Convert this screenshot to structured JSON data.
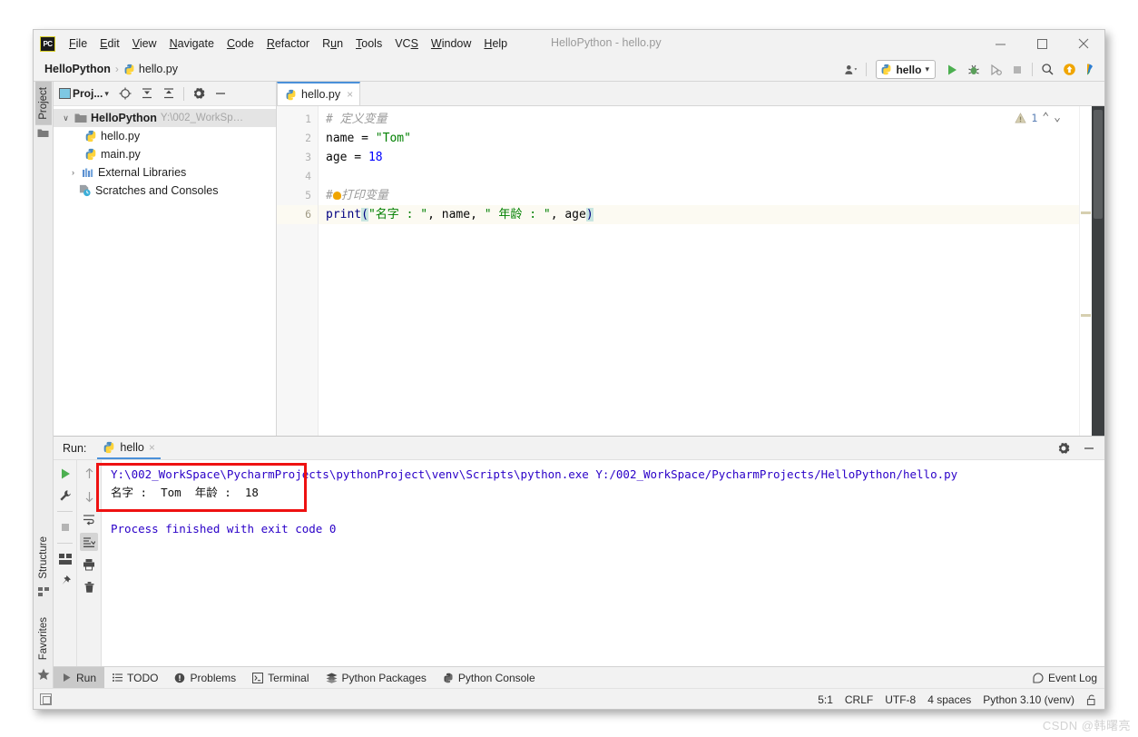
{
  "window": {
    "title": "HelloPython - hello.py",
    "logo_text": "PC",
    "minimize": "—",
    "maximize": "□",
    "close": "×"
  },
  "menu": [
    {
      "label": "File",
      "mnemonic": "F"
    },
    {
      "label": "Edit",
      "mnemonic": "E"
    },
    {
      "label": "View",
      "mnemonic": "V"
    },
    {
      "label": "Navigate",
      "mnemonic": "N"
    },
    {
      "label": "Code",
      "mnemonic": "C"
    },
    {
      "label": "Refactor",
      "mnemonic": "R"
    },
    {
      "label": "Run",
      "mnemonic": "u"
    },
    {
      "label": "Tools",
      "mnemonic": "T"
    },
    {
      "label": "VCS",
      "mnemonic": "S"
    },
    {
      "label": "Window",
      "mnemonic": "W"
    },
    {
      "label": "Help",
      "mnemonic": "H"
    }
  ],
  "navbar": {
    "crumb_project": "HelloPython",
    "crumb_sep": "›",
    "crumb_file": "hello.py",
    "run_config": "hello",
    "run_config_caret": "▾",
    "profile_caret": "▾"
  },
  "left_rail": {
    "project_tab": "Project",
    "structure_tab": "Structure",
    "favorites_tab": "Favorites"
  },
  "project_panel": {
    "title": "Proj...",
    "title_caret": "▾",
    "tree": [
      {
        "label": "HelloPython",
        "path": "Y:\\002_WorkSp…",
        "arrow": "∨",
        "bold": true,
        "selected": true,
        "indent": 0,
        "icon": "folder-icon"
      },
      {
        "label": "hello.py",
        "path": "",
        "arrow": "",
        "bold": false,
        "selected": false,
        "indent": 1,
        "icon": "python-file-icon"
      },
      {
        "label": "main.py",
        "path": "",
        "arrow": "",
        "bold": false,
        "selected": false,
        "indent": 1,
        "icon": "python-file-icon"
      },
      {
        "label": "External Libraries",
        "path": "",
        "arrow": "›",
        "bold": false,
        "selected": false,
        "indent": 0,
        "icon": "library-icon"
      },
      {
        "label": "Scratches and Consoles",
        "path": "",
        "arrow": "",
        "bold": false,
        "selected": false,
        "indent": 0,
        "icon": "scratches-icon"
      }
    ]
  },
  "editor": {
    "tab_name": "hello.py",
    "tab_close": "×",
    "inspection_count": "1",
    "inspection_up": "⌃",
    "inspection_down": "⌄",
    "line_numbers": [
      "1",
      "2",
      "3",
      "4",
      "5",
      "6"
    ],
    "current_line": 6,
    "code": {
      "l1_comment": "# 定义变量",
      "l2_var": "name",
      "l2_eq": " = ",
      "l2_str": "\"Tom\"",
      "l3_var": "age",
      "l3_eq": " = ",
      "l3_num": "18",
      "l4_blank": "",
      "l5_hash": "#",
      "l5_comment": "打印变量",
      "l6_fn": "print",
      "l6_open": "(",
      "l6_str1": "\"名字 : \"",
      "l6_c1": ", ",
      "l6_v1": "name",
      "l6_c2": ", ",
      "l6_str2": "\" 年龄 : \"",
      "l6_c3": ", ",
      "l6_v2": "age",
      "l6_close": ")"
    }
  },
  "run_panel": {
    "label": "Run:",
    "tab_name": "hello",
    "tab_close": "×",
    "console_lines": [
      {
        "text": "Y:\\002_WorkSpace\\PycharmProjects\\pythonProject\\venv\\Scripts\\python.exe Y:/002_WorkSpace/PycharmProjects/HelloPython/hello.py",
        "kind": "cmd"
      },
      {
        "text": "名字 :  Tom  年龄 :  18",
        "kind": "out"
      },
      {
        "text": "",
        "kind": "blank"
      },
      {
        "text": "Process finished with exit code 0",
        "kind": "cmd"
      }
    ]
  },
  "bottom_bar": {
    "buttons": [
      {
        "label": "Run",
        "icon": "play-icon",
        "active": true
      },
      {
        "label": "TODO",
        "icon": "todo-icon",
        "active": false
      },
      {
        "label": "Problems",
        "icon": "problems-icon",
        "active": false
      },
      {
        "label": "Terminal",
        "icon": "terminal-icon",
        "active": false
      },
      {
        "label": "Python Packages",
        "icon": "packages-icon",
        "active": false
      },
      {
        "label": "Python Console",
        "icon": "python-icon",
        "active": false
      }
    ],
    "event_log": "Event Log"
  },
  "status_bar": {
    "caret": "5:1",
    "line_sep": "CRLF",
    "encoding": "UTF-8",
    "indent": "4 spaces",
    "interpreter": "Python 3.10 (venv)"
  },
  "watermark": "CSDN @韩曙亮",
  "colors": {
    "accent_blue": "#4a90d9",
    "run_green": "#4caf50",
    "warn_yellow": "#d6cfb0",
    "annotation_red": "#ee1111",
    "string_green": "#008000",
    "keyword_navy": "#000080",
    "number_blue": "#0000ff",
    "console_blue": "#2a00c8"
  }
}
